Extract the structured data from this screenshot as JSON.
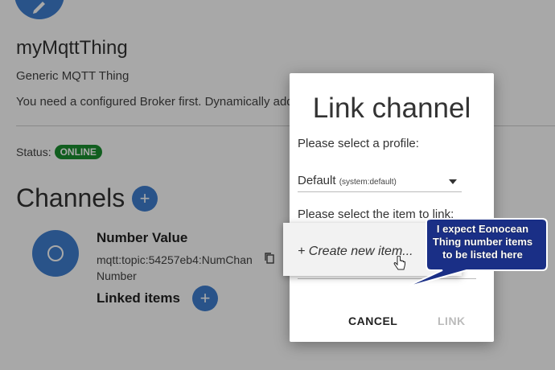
{
  "thing": {
    "title": "myMqttThing",
    "subtitle": "Generic MQTT Thing",
    "note": "You need a configured Broker first. Dynamically add ch                                                  nk different M",
    "status_label": "Status:",
    "status_badge": "ONLINE",
    "status_color": "#1b8f2f"
  },
  "channels": {
    "heading": "Channels",
    "add_icon": "plus-icon",
    "items": [
      {
        "name": "Number Value",
        "uid": "mqtt:topic:54257eb4:NumChan",
        "type": "Number",
        "linked_label": "Linked items",
        "icon": "circle-icon",
        "copy_icon": "copy-icon"
      }
    ]
  },
  "dialog": {
    "title": "Link channel",
    "profile_label": "Please select a profile:",
    "profile_value": "Default",
    "profile_value_small": "(system:default)",
    "item_label": "Please select the item to link:",
    "menu_items": [
      "+ Create new item..."
    ],
    "cancel_label": "CANCEL",
    "link_label": "LINK"
  },
  "callout": {
    "text": "I expect Eonocean Thing number items to be listed here",
    "fill": "#1a2f86"
  },
  "colors": {
    "accent": "#3f7fd0"
  }
}
